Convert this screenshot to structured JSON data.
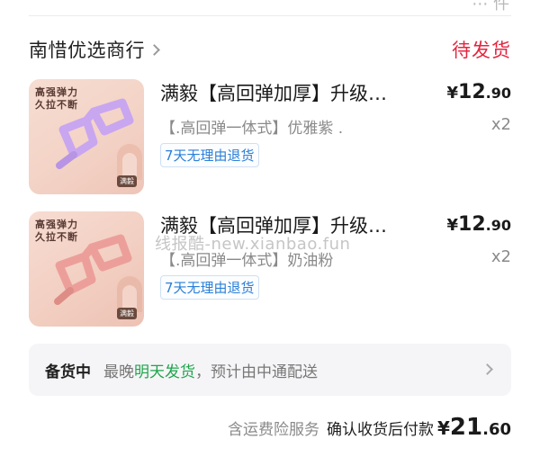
{
  "top_peek_glyph": "⋯ 件",
  "shop": {
    "name": "南惜优选商行",
    "status": "待发货",
    "status_color": "#e3263f"
  },
  "items": [
    {
      "title": "满毅【高回弹加厚】升级…",
      "spec": "【.高回弹一体式】优雅紫 .",
      "price_symbol": "¥",
      "price_int": "12",
      "price_dec": ".90",
      "qty": "x2",
      "badge": "7天无理由退货",
      "image_slogan": "高强弹力\n久拉不断",
      "image_brand": "满毅",
      "band_color": "#c9a6f0"
    },
    {
      "title": "满毅【高回弹加厚】升级…",
      "spec": "【.高回弹一体式】奶油粉",
      "price_symbol": "¥",
      "price_int": "12",
      "price_dec": ".90",
      "qty": "x2",
      "badge": "7天无理由退货",
      "image_slogan": "高强弹力\n久拉不断",
      "image_brand": "满毅",
      "band_color": "#ec9f9a"
    }
  ],
  "watermark": "线报酷-new.xianbao.fun",
  "stock": {
    "status": "备货中",
    "desc_prefix": "最晚",
    "desc_highlight": "明天发货",
    "desc_suffix": "，预计由中通配送",
    "highlight_color": "#1fa44c"
  },
  "footer": {
    "service": "含运费险服务",
    "label": "确认收货后付款",
    "total_symbol": "¥",
    "total_int": "21",
    "total_dec": ".60"
  }
}
